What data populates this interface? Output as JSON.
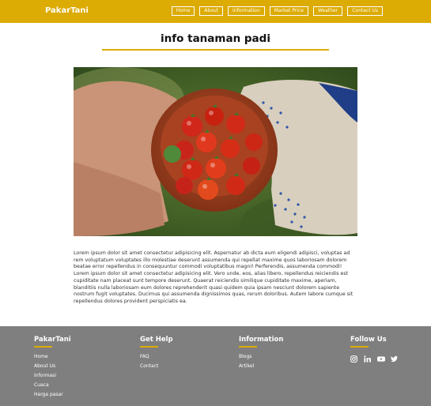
{
  "header": {
    "brand": "PakarTani",
    "nav": [
      "Home",
      "About",
      "Information",
      "Market Price",
      "Weather",
      "Contact Us"
    ]
  },
  "main": {
    "title": "info tanaman padi",
    "image_alt": "hands holding a bowl of tomatoes",
    "paragraph": "Lorem ipsum dolor sit amet consectetur adipisicing elit. Aspernatur ab dicta eum eligendi adipisci, voluptas ad rem voluptatum voluptates illo molestiae deserunt assumenda qui repellat maxime quos laboriosam dolorem beatae error repellendus in consequuntur commodi voluptatibus magni! Perferendis, assumenda commodi! Lorem ipsum dolor sit amet consectetur adipisicing elit. Vero unde, eos, alias libero, repellendus reiciendis est cupiditate nam placeat sunt tempore deserunt. Quaerat reiciendis similique cupiditate maxime, aperiam, blanditiis nulla laboriosam eum dolores reprehenderit quasi quidem quia ipsam nesciunt dolorem sapiente nostrum fugit voluptates. Ducimus qui assumenda dignissimos quas, rerum doloribus. Autem labore cumque sit repellendus dolores provident perspiciatis ea."
  },
  "footer": {
    "brand": {
      "heading": "PakarTani",
      "links": [
        "Home",
        "About Us",
        "Informasi",
        "Cuaca",
        "Harga pasar"
      ]
    },
    "help": {
      "heading": "Get Help",
      "links": [
        "FAQ",
        "Contact"
      ]
    },
    "info": {
      "heading": "Information",
      "links": [
        "Blogs",
        "Artikel"
      ]
    },
    "follow": {
      "heading": "Follow Us",
      "icons": [
        "instagram-icon",
        "linkedin-icon",
        "youtube-icon",
        "twitter-icon"
      ]
    }
  },
  "colors": {
    "accent": "#dcab04",
    "footer_bg": "#7f7f7f",
    "header_bg": "#dcab04"
  }
}
